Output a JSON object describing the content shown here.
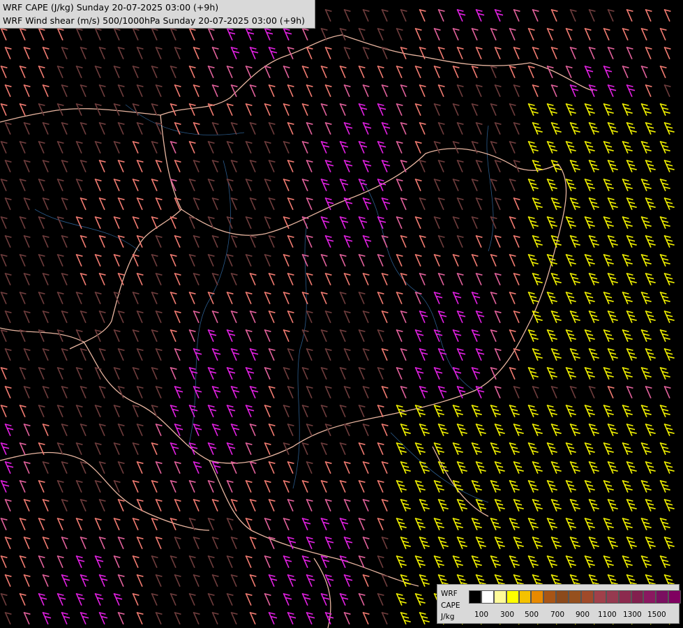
{
  "titles": {
    "line1": "WRF CAPE (J/kg) Sunday 20-07-2025 03:00 (+9h)",
    "line2": "WRF Wind shear (m/s) 500/1000hPa Sunday 20-07-2025 03:00 (+9h)"
  },
  "legend": {
    "label_wrf": "WRF",
    "label_cape": "CAPE",
    "label_unit": "J/kg",
    "ticks": [
      "100",
      "300",
      "500",
      "700",
      "900",
      "1100",
      "1300",
      "1500"
    ],
    "colors": [
      "#000000",
      "#ffffff",
      "#fffb99",
      "#ffff00",
      "#f5c200",
      "#e88a00",
      "#a85516",
      "#8c4a1c",
      "#96501e",
      "#a04a2a",
      "#a0404a",
      "#963a50",
      "#8c2a4e",
      "#82204e",
      "#8a1860",
      "#7a1060",
      "#800060"
    ]
  },
  "barb_colors": {
    "dark": "#6e3c3c",
    "salmon": "#f07a70",
    "pink": "#e0609a",
    "magenta": "#e020e0",
    "yellow": "#f0f000"
  }
}
